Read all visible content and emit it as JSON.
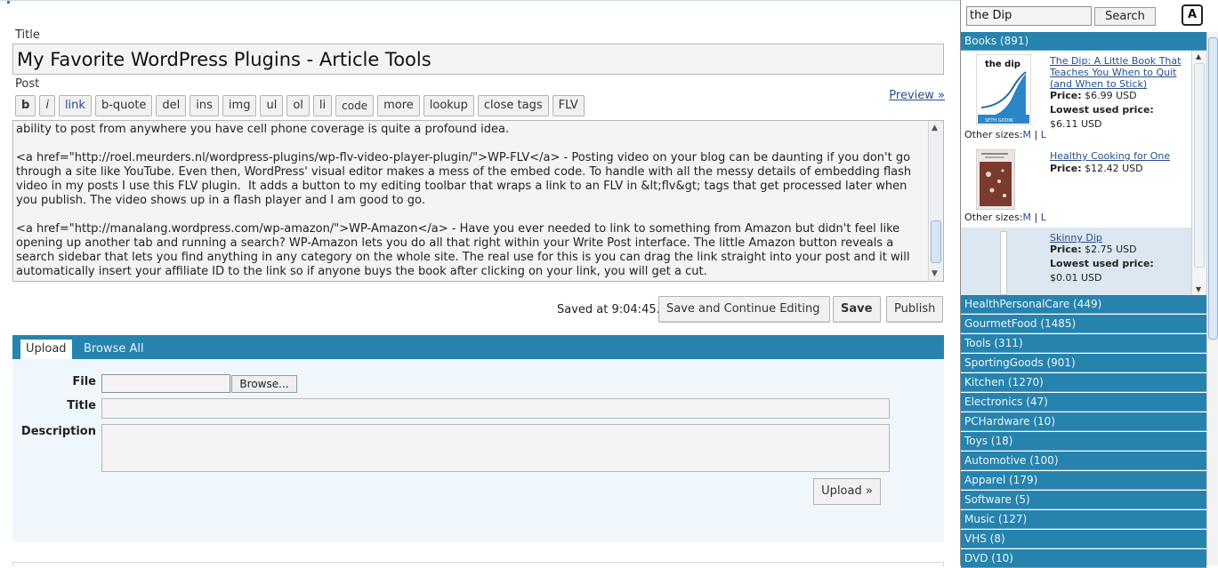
{
  "editor": {
    "title_label": "Title",
    "title_value": "My Favorite WordPress Plugins - Article Tools",
    "post_label": "Post",
    "preview_link": "Preview »",
    "toolbar": [
      "b",
      "i",
      "link",
      "b-quote",
      "del",
      "ins",
      "img",
      "ul",
      "ol",
      "li",
      "code",
      "more",
      "lookup",
      "close tags",
      "FLV"
    ],
    "post_body": "ability to post from anywhere you have cell phone coverage is quite a profound idea.\n\n<a href=\"http://roel.meurders.nl/wordpress-plugins/wp-flv-video-player-plugin/\">WP-FLV</a> - Posting video on your blog can be daunting if you don't go through a site like YouTube. Even then, WordPress' visual editor makes a mess of the embed code. To handle with all the messy details of embedding flash video in my posts I use this FLV plugin.  It adds a button to my editing toolbar that wraps a link to an FLV in &lt;flv&gt; tags that get processed later when you publish. The video shows up in a flash player and I am good to go.\n\n<a href=\"http://manalang.wordpress.com/wp-amazon/\">WP-Amazon</a> - Have you ever needed to link to something from Amazon but didn't feel like opening up another tab and running a search? WP-Amazon lets you do all that right within your Write Post interface. The little Amazon button reveals a search sidebar that lets you find anything in any category on the whole site. The real use for this is you can drag the link straight into your post and it will automatically insert your affiliate ID to the link so if anyone buys the book after clicking on your link, you will get a cut.",
    "saved_status": "Saved at 9:04:45.",
    "save_continue_label": "Save and Continue Editing",
    "save_label": "Save",
    "publish_label": "Publish"
  },
  "upload": {
    "tab_upload": "Upload",
    "tab_browse": "Browse All",
    "file_label": "File",
    "browse_label": "Browse...",
    "title_label": "Title",
    "description_label": "Description",
    "upload_button": "Upload »"
  },
  "amazon": {
    "search_value": "the Dip",
    "search_button": "Search",
    "logo_text": "A",
    "books_category": "Books (891)",
    "results": [
      {
        "title": "The Dip: A Little Book That Teaches You When to Quit (and When to Stick)",
        "price_label": "Price:",
        "price": "$6.99 USD",
        "used_label": "Lowest used price:",
        "used_price": "$6.11 USD",
        "other_sizes_label": "Other sizes:",
        "size_m": "M",
        "size_l": "L",
        "cover_title": "the dip",
        "cover_author": "SETH GODIN"
      },
      {
        "title": "Healthy Cooking for One",
        "price_label": "Price:",
        "price": "$12.42 USD",
        "other_sizes_label": "Other sizes:",
        "size_m": "M",
        "size_l": "L"
      },
      {
        "title": "Skinny Dip",
        "price_label": "Price:",
        "price": "$2.75 USD",
        "used_label": "Lowest used price:",
        "used_price": "$0.01 USD"
      }
    ],
    "categories": [
      "HealthPersonalCare (449)",
      "GourmetFood (1485)",
      "Tools (311)",
      "SportingGoods (901)",
      "Kitchen (1270)",
      "Electronics (47)",
      "PCHardware (10)",
      "Toys (18)",
      "Automotive (100)",
      "Apparel (179)",
      "Software (5)",
      "Music (127)",
      "VHS (8)",
      "DVD (10)"
    ],
    "colors": {
      "category_bar": "#2683ae",
      "books_panel": "#dde7f1",
      "link": "#264e8c"
    }
  }
}
